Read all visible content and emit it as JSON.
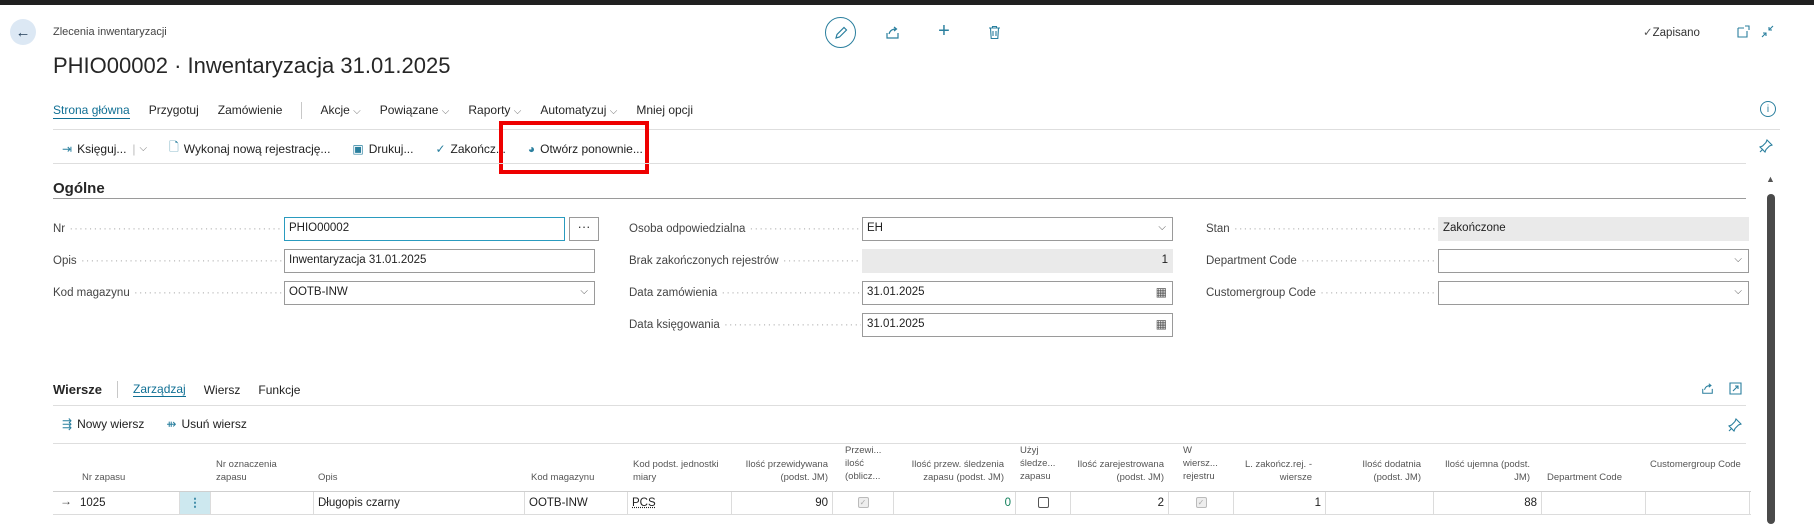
{
  "header": {
    "breadcrumb": "Zlecenia inwentaryzacji",
    "title": "PHIO00002 · Inwentaryzacja 31.01.2025",
    "saved_label": "Zapisano"
  },
  "menu": {
    "items": [
      "Strona główna",
      "Przygotuj",
      "Zamówienie",
      "Akcje",
      "Powiązane",
      "Raporty",
      "Automatyzuj",
      "Mniej opcji"
    ]
  },
  "actions": {
    "post": "Księguj...",
    "new_registration": "Wykonaj nową rejestrację...",
    "print": "Drukuj...",
    "finish": "Zakończ...",
    "reopen": "Otwórz ponownie..."
  },
  "general": {
    "section_title": "Ogólne",
    "no_label": "Nr",
    "no_value": "PHIO00002",
    "desc_label": "Opis",
    "desc_value": "Inwentaryzacja 31.01.2025",
    "location_label": "Kod magazynu",
    "location_value": "OOTB-INW",
    "person_label": "Osoba odpowiedzialna",
    "person_value": "EH",
    "unfinished_label": "Brak zakończonych rejestrów",
    "unfinished_value": "1",
    "order_date_label": "Data zamówienia",
    "order_date_value": "31.01.2025",
    "posting_date_label": "Data księgowania",
    "posting_date_value": "31.01.2025",
    "status_label": "Stan",
    "status_value": "Zakończone",
    "dept_label": "Department Code",
    "dept_value": "",
    "custgroup_label": "Customergroup Code",
    "custgroup_value": ""
  },
  "lines": {
    "title": "Wiersze",
    "tabs": [
      "Zarządzaj",
      "Wiersz",
      "Funkcje"
    ],
    "new_line": "Nowy wiersz",
    "delete_line": "Usuń wiersz",
    "columns": {
      "item_no": "Nr zapasu",
      "variant": "Nr oznaczenia zapasu",
      "description": "Opis",
      "location": "Kod magazynu",
      "base_uom": "Kod podst. jednostki miary",
      "qty_expected": "Ilość przewidywana (podst. JM)",
      "qty_calc": "Przewi... ilość (oblicz...",
      "qty_track": "Ilość przew. śledzenia zapasu (podst. JM)",
      "use_track": "Użyj śledze... zapasu",
      "qty_recorded": "Ilość zarejestrowana (podst. JM)",
      "in_rec": "W wiersz... rejestru",
      "finished_rec": "L. zakończ.rej. - wiersze",
      "pos_qty": "Ilość dodatnia (podst. JM)",
      "neg_qty": "Ilość ujemna (podst. JM)",
      "dept": "Department Code",
      "custgroup": "Customergroup Code"
    },
    "row": {
      "item_no": "1025",
      "variant": "",
      "description": "Długopis czarny",
      "location": "OOTB-INW",
      "base_uom": "PCS",
      "qty_expected": "90",
      "qty_track": "0",
      "qty_recorded": "2",
      "finished_rec": "1",
      "pos_qty": "",
      "neg_qty": "88"
    }
  }
}
